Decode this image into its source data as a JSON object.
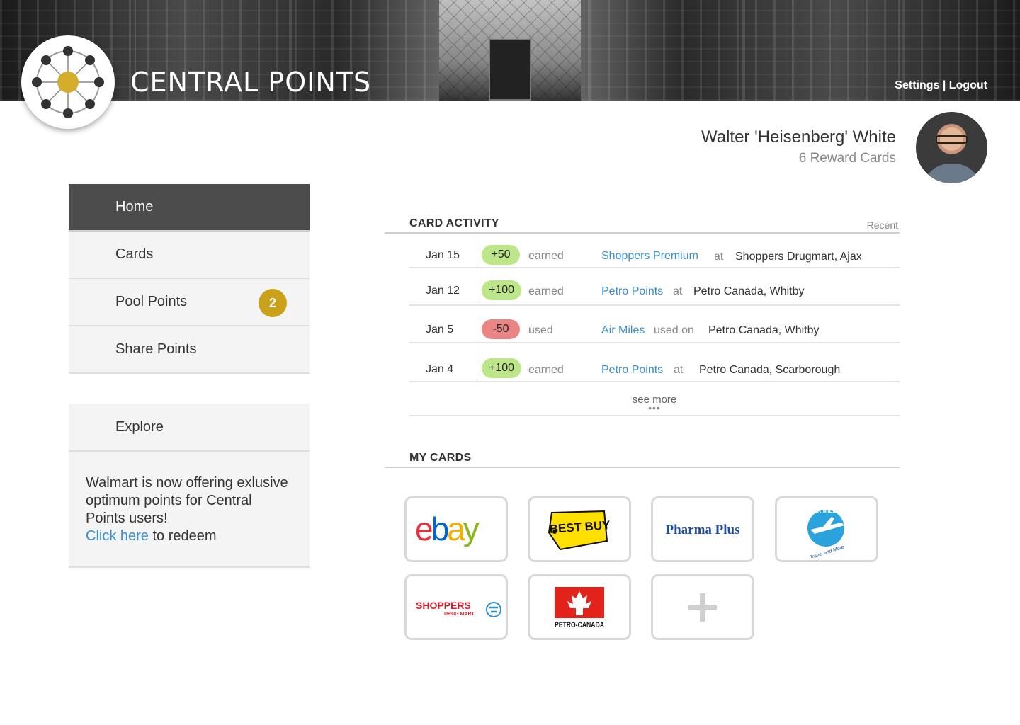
{
  "app": {
    "title": "CENTRAL POINTS"
  },
  "header": {
    "settings_label": "Settings",
    "separator": " | ",
    "logout_label": "Logout"
  },
  "profile": {
    "name": "Walter 'Heisenberg' White",
    "subtitle": "6 Reward Cards"
  },
  "nav": {
    "items": [
      {
        "label": "Home",
        "active": true
      },
      {
        "label": "Cards"
      },
      {
        "label": "Pool Points",
        "badge": "2"
      },
      {
        "label": "Share Points"
      }
    ]
  },
  "explore": {
    "title": "Explore",
    "message": "Walmart is now offering exlusive optimum points for Central Points users!",
    "link_label": "Click here",
    "link_suffix": " to redeem"
  },
  "activity": {
    "title": "CARD ACTIVITY",
    "filter_label": "Recent",
    "rows": [
      {
        "date": "Jan 15",
        "points": "+50",
        "type": "pos",
        "verb": "earned",
        "program": "Shoppers Premium",
        "prep": "at",
        "place": "Shoppers Drugmart, Ajax"
      },
      {
        "date": "Jan 12",
        "points": "+100",
        "type": "pos",
        "verb": "earned",
        "program": "Petro Points",
        "prep": "at",
        "place": "Petro Canada, Whitby"
      },
      {
        "date": "Jan 5",
        "points": "-50",
        "type": "neg",
        "verb": "used",
        "program": "Air Miles",
        "prep": "used on",
        "place": "Petro Canada, Whitby"
      },
      {
        "date": "Jan 4",
        "points": "+100",
        "type": "pos",
        "verb": "earned",
        "program": "Petro Points",
        "prep": "at",
        "place": "Petro Canada, Scarborough"
      }
    ],
    "see_more_label": "see more",
    "see_more_dots": "•••"
  },
  "my_cards": {
    "title": "MY CARDS",
    "cards": [
      {
        "name": "ebay-card",
        "logo_text": "ebay"
      },
      {
        "name": "best-buy-card",
        "logo_text": "BEST BUY"
      },
      {
        "name": "pharma-plus-card",
        "logo_text": "Pharma Plus"
      },
      {
        "name": "air-miles-card",
        "logo_text": "AIR MILES",
        "logo_subtext": "Travel and More"
      },
      {
        "name": "shoppers-card",
        "logo_text": "SHOPPERS",
        "logo_subtext": "DRUG MART"
      },
      {
        "name": "petro-canada-card",
        "logo_text": "PETRO-CANADA"
      },
      {
        "name": "add-card",
        "icon": "plus-icon"
      }
    ]
  },
  "colors": {
    "accent_blue": "#3b8ed0",
    "badge_gold": "#c9a21a",
    "earned_green": "#bde58a",
    "used_red": "#e98585",
    "nav_active": "#4c4c4c"
  }
}
